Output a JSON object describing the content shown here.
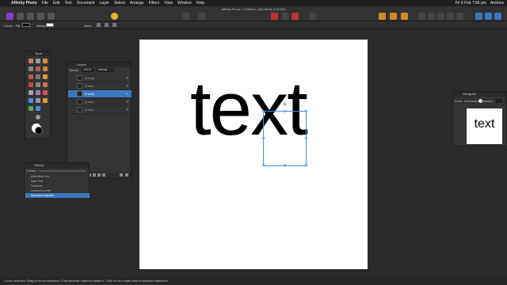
{
  "menubar": {
    "app": "Affinity Photo",
    "items": [
      "File",
      "Edit",
      "Text",
      "Document",
      "Layer",
      "Select",
      "Arrange",
      "Filters",
      "View",
      "Window",
      "Help"
    ],
    "clock": "Fri 9 Feb 7:56 pm",
    "user": "Andrew"
  },
  "toolbar": {
    "doc_title": "Affinity Photo - <Untitled> [Modified] (123.6%)"
  },
  "context": {
    "curve": "Curve",
    "fill": "Fill:",
    "stroke": "Stroke:",
    "none": "None"
  },
  "canvas": {
    "text": "text"
  },
  "tools": {
    "title": "Tools"
  },
  "layers": {
    "title": "Layers",
    "opacity_label": "Opacity:",
    "opacity": "100 %",
    "blend": "Normal",
    "rows": [
      {
        "name": "(Group)"
      },
      {
        "name": "(Curve)"
      },
      {
        "name": "(Curve)"
      },
      {
        "name": "(Curve)"
      },
      {
        "name": "(Curve)"
      }
    ]
  },
  "history": {
    "title": "History",
    "position_label": "Position:",
    "rows": [
      "Add Artistic Text",
      "Insert \"text\"",
      "Transform",
      "Convert to curves",
      "Set current selection"
    ]
  },
  "navigator": {
    "title": "Navigator",
    "zoom_label": "Zoom:",
    "thumb_text": "text"
  },
  "status": {
    "text": "Curve selected. Drag to move selection. Click another object to select it. Click on an empty area to deselect selection."
  },
  "colors": {
    "accent": "#3c78c0",
    "selection": "#4a8fe0"
  }
}
